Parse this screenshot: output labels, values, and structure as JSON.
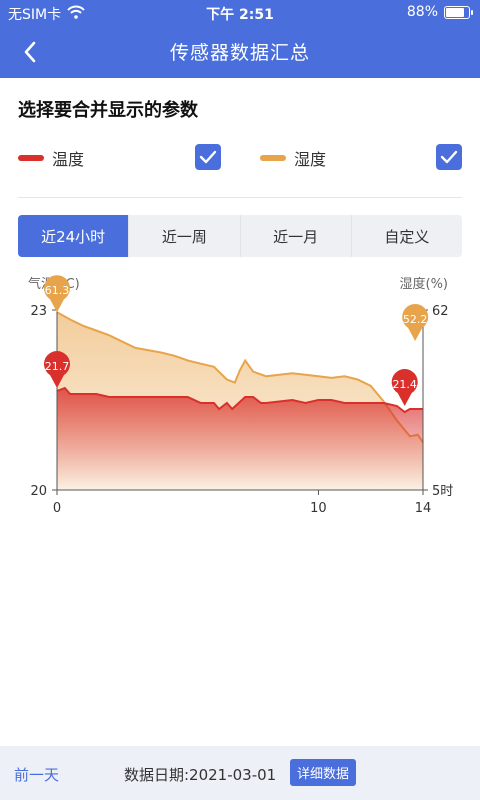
{
  "status_bar": {
    "carrier": "无SIM卡",
    "time": "下午 2:51",
    "battery": "88%",
    "battery_level": 0.88
  },
  "nav": {
    "title": "传感器数据汇总",
    "back_icon": "chevron-left-icon"
  },
  "params": {
    "title": "选择要合并显示的参数",
    "items": [
      {
        "label": "温度",
        "color": "#d9302c",
        "checked": true
      },
      {
        "label": "湿度",
        "color": "#e8a44a",
        "checked": true
      }
    ]
  },
  "range_tabs": [
    {
      "label": "近24小时",
      "active": true
    },
    {
      "label": "近一周",
      "active": false
    },
    {
      "label": "近一月",
      "active": false
    },
    {
      "label": "自定义",
      "active": false
    }
  ],
  "colors": {
    "primary": "#4a6fdc",
    "temperature": "#d9302c",
    "humidity": "#e8a44a"
  },
  "chart_data": {
    "type": "area",
    "left_axis_label": "气温(°C)",
    "right_axis_label": "湿度(%)",
    "left_ylim": [
      20,
      23
    ],
    "right_ylim": [
      5,
      62
    ],
    "left_ticks": [
      "23",
      "20"
    ],
    "right_ticks": [
      "62",
      "5时"
    ],
    "x_ticks": [
      "0",
      "10",
      "14"
    ],
    "xlim": [
      0,
      14
    ],
    "series": [
      {
        "name": "温度",
        "axis": "left",
        "x": [
          0,
          0.3,
          0.5,
          0.8,
          1.0,
          1.5,
          2,
          3,
          4,
          5,
          5.5,
          6,
          6.2,
          6.5,
          6.7,
          7.2,
          7.5,
          7.8,
          8,
          9,
          9.5,
          10,
          10.5,
          11,
          11.5,
          12,
          12.5,
          13,
          13.3,
          13.5,
          14
        ],
        "values": [
          21.65,
          21.7,
          21.6,
          21.6,
          21.6,
          21.6,
          21.55,
          21.55,
          21.55,
          21.55,
          21.45,
          21.45,
          21.35,
          21.45,
          21.35,
          21.55,
          21.55,
          21.45,
          21.45,
          21.5,
          21.45,
          21.5,
          21.5,
          21.45,
          21.45,
          21.45,
          21.45,
          21.4,
          21.3,
          21.35,
          21.35
        ]
      },
      {
        "name": "湿度",
        "axis": "right",
        "x": [
          0,
          0.5,
          1.0,
          1.5,
          2,
          3,
          4,
          4.5,
          5,
          5.5,
          6,
          6.5,
          6.8,
          7,
          7.2,
          7.5,
          8,
          8.5,
          9,
          9.5,
          10,
          10.5,
          11,
          11.5,
          12,
          12.5,
          13,
          13.5,
          13.8,
          14
        ],
        "values": [
          61.3,
          59,
          57,
          55.5,
          54,
          50,
          48.5,
          47.5,
          46,
          45,
          44,
          40,
          39,
          43,
          46,
          42.5,
          41,
          41.5,
          42,
          41.5,
          41,
          40.5,
          41,
          40,
          38,
          33,
          27,
          22,
          22.5,
          20
        ]
      }
    ],
    "markers": [
      {
        "series": "湿度",
        "x": 0,
        "value": 61.3,
        "label": "61.3"
      },
      {
        "series": "温度",
        "x": 0,
        "value": 21.7,
        "label": "21.7"
      },
      {
        "series": "温度",
        "x": 13.3,
        "value": 21.4,
        "label": "21.4"
      },
      {
        "series": "湿度",
        "x": 13.7,
        "value": 52.2,
        "label": "52.2"
      }
    ]
  },
  "footer": {
    "prev_day": "前一天",
    "date_label": "数据日期:2021-03-01",
    "detail_button": "详细数据"
  }
}
